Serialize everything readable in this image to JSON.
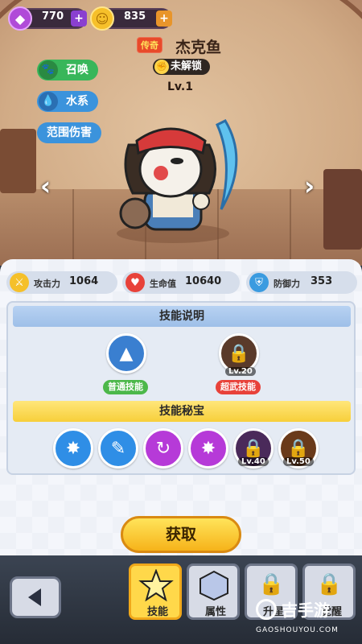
{
  "resources": {
    "gems": "770",
    "coins": "835",
    "plus": "+"
  },
  "hero": {
    "rarity": "传奇",
    "name": "杰克鱼",
    "lock_status": "未解锁",
    "level": "Lv.1",
    "tags": [
      "召唤",
      "水系",
      "范围伤害"
    ]
  },
  "stats": [
    {
      "label": "攻击力",
      "value": "1064",
      "icon": "sword-icon",
      "color": "#f5c02a"
    },
    {
      "label": "生命值",
      "value": "10640",
      "icon": "heart-icon",
      "color": "#e8423a"
    },
    {
      "label": "防御力",
      "value": "353",
      "icon": "shield-icon",
      "color": "#3a9be0"
    }
  ],
  "skills": {
    "section_title": "技能说明",
    "normal": {
      "label": "普通技能"
    },
    "ultimate": {
      "label": "超武技能",
      "lock_level": "Lv.20"
    }
  },
  "treasures": {
    "section_title": "技能秘宝",
    "locks": [
      "Lv.40",
      "Lv.50"
    ]
  },
  "obtain_label": "获取",
  "tabs": [
    {
      "label": "技能",
      "active": true
    },
    {
      "label": "属性",
      "active": false
    },
    {
      "label": "升星",
      "active": false
    },
    {
      "label": "觉醒",
      "active": false
    }
  ],
  "watermark": {
    "brand": "吉手游",
    "url": "GAOSHOUYOU.COM"
  },
  "colors": {
    "accent_yellow": "#f7cf3a",
    "summon_green": "#38b65a",
    "water_blue": "#3b93dc",
    "ultimate_red": "#e8423a"
  }
}
